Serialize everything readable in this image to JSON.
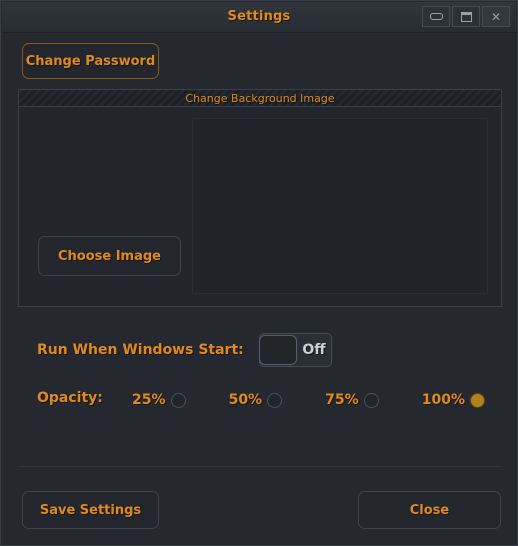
{
  "window": {
    "title": "Settings",
    "controls": [
      {
        "name": "minimize",
        "glyph": "minimize-icon",
        "label": "_"
      },
      {
        "name": "maximize",
        "glyph": "maximize-icon",
        "label": "□"
      },
      {
        "name": "close",
        "glyph": "close-icon",
        "label": "X"
      }
    ]
  },
  "change_password": {
    "label": "Change Password"
  },
  "background_group": {
    "title": "Change Background Image",
    "choose_image_label": "Choose Image",
    "preview_alt": ""
  },
  "startup": {
    "label": "Run When Windows Start:",
    "toggle_state": "Off"
  },
  "opacity": {
    "label": "Opacity:",
    "options": [
      {
        "label": "25%",
        "selected": false
      },
      {
        "label": "50%",
        "selected": false
      },
      {
        "label": "75%",
        "selected": false
      },
      {
        "label": "100%",
        "selected": true
      }
    ]
  },
  "footer": {
    "save_label": "Save Settings",
    "close_label": "Close"
  },
  "colors": {
    "accent": "#e08a1e",
    "accent_muted": "#d98a24",
    "radio_selected": "#b3801e",
    "window_bg": "#25282e",
    "panel_bg": "#22252b",
    "border": "#3b3f48"
  }
}
